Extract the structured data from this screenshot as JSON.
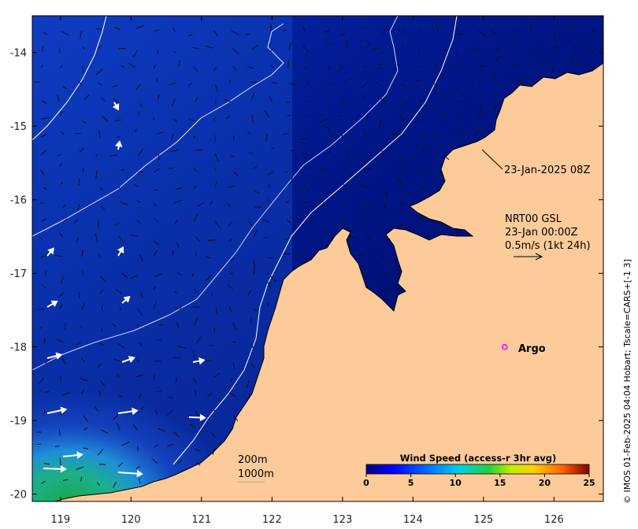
{
  "map": {
    "x_ticks": [
      "119",
      "120",
      "121",
      "122",
      "123",
      "124",
      "125",
      "126"
    ],
    "y_ticks": [
      "-14",
      "-15",
      "-16",
      "-17",
      "-18",
      "-19",
      "-20"
    ],
    "lon_range": [
      118.6,
      126.7
    ],
    "lat_range": [
      -20.1,
      -13.5
    ],
    "land_color": "#fccb99",
    "contours": {
      "c200": "200m",
      "c1000": "1000m"
    },
    "track_label": "23-Jan-2025 08Z",
    "legend": {
      "line1": "NRT00 GSL",
      "line2": "23-Jan 00:00Z",
      "line3": "0.5m/s (1kt 24h)"
    },
    "argo": {
      "label": "Argo",
      "lon": 125.3,
      "lat": -18.0,
      "color": "#ff00ff"
    },
    "side_label": "© IMOS 01-Feb-2025 04:04 Hobart; Tscale=CARS+[-1 3]",
    "colorbar": {
      "title": "Wind Speed (access-r 3hr avg)",
      "ticks": [
        "0",
        "5",
        "10",
        "15",
        "20",
        "25"
      ],
      "range": [
        0,
        25
      ]
    }
  }
}
